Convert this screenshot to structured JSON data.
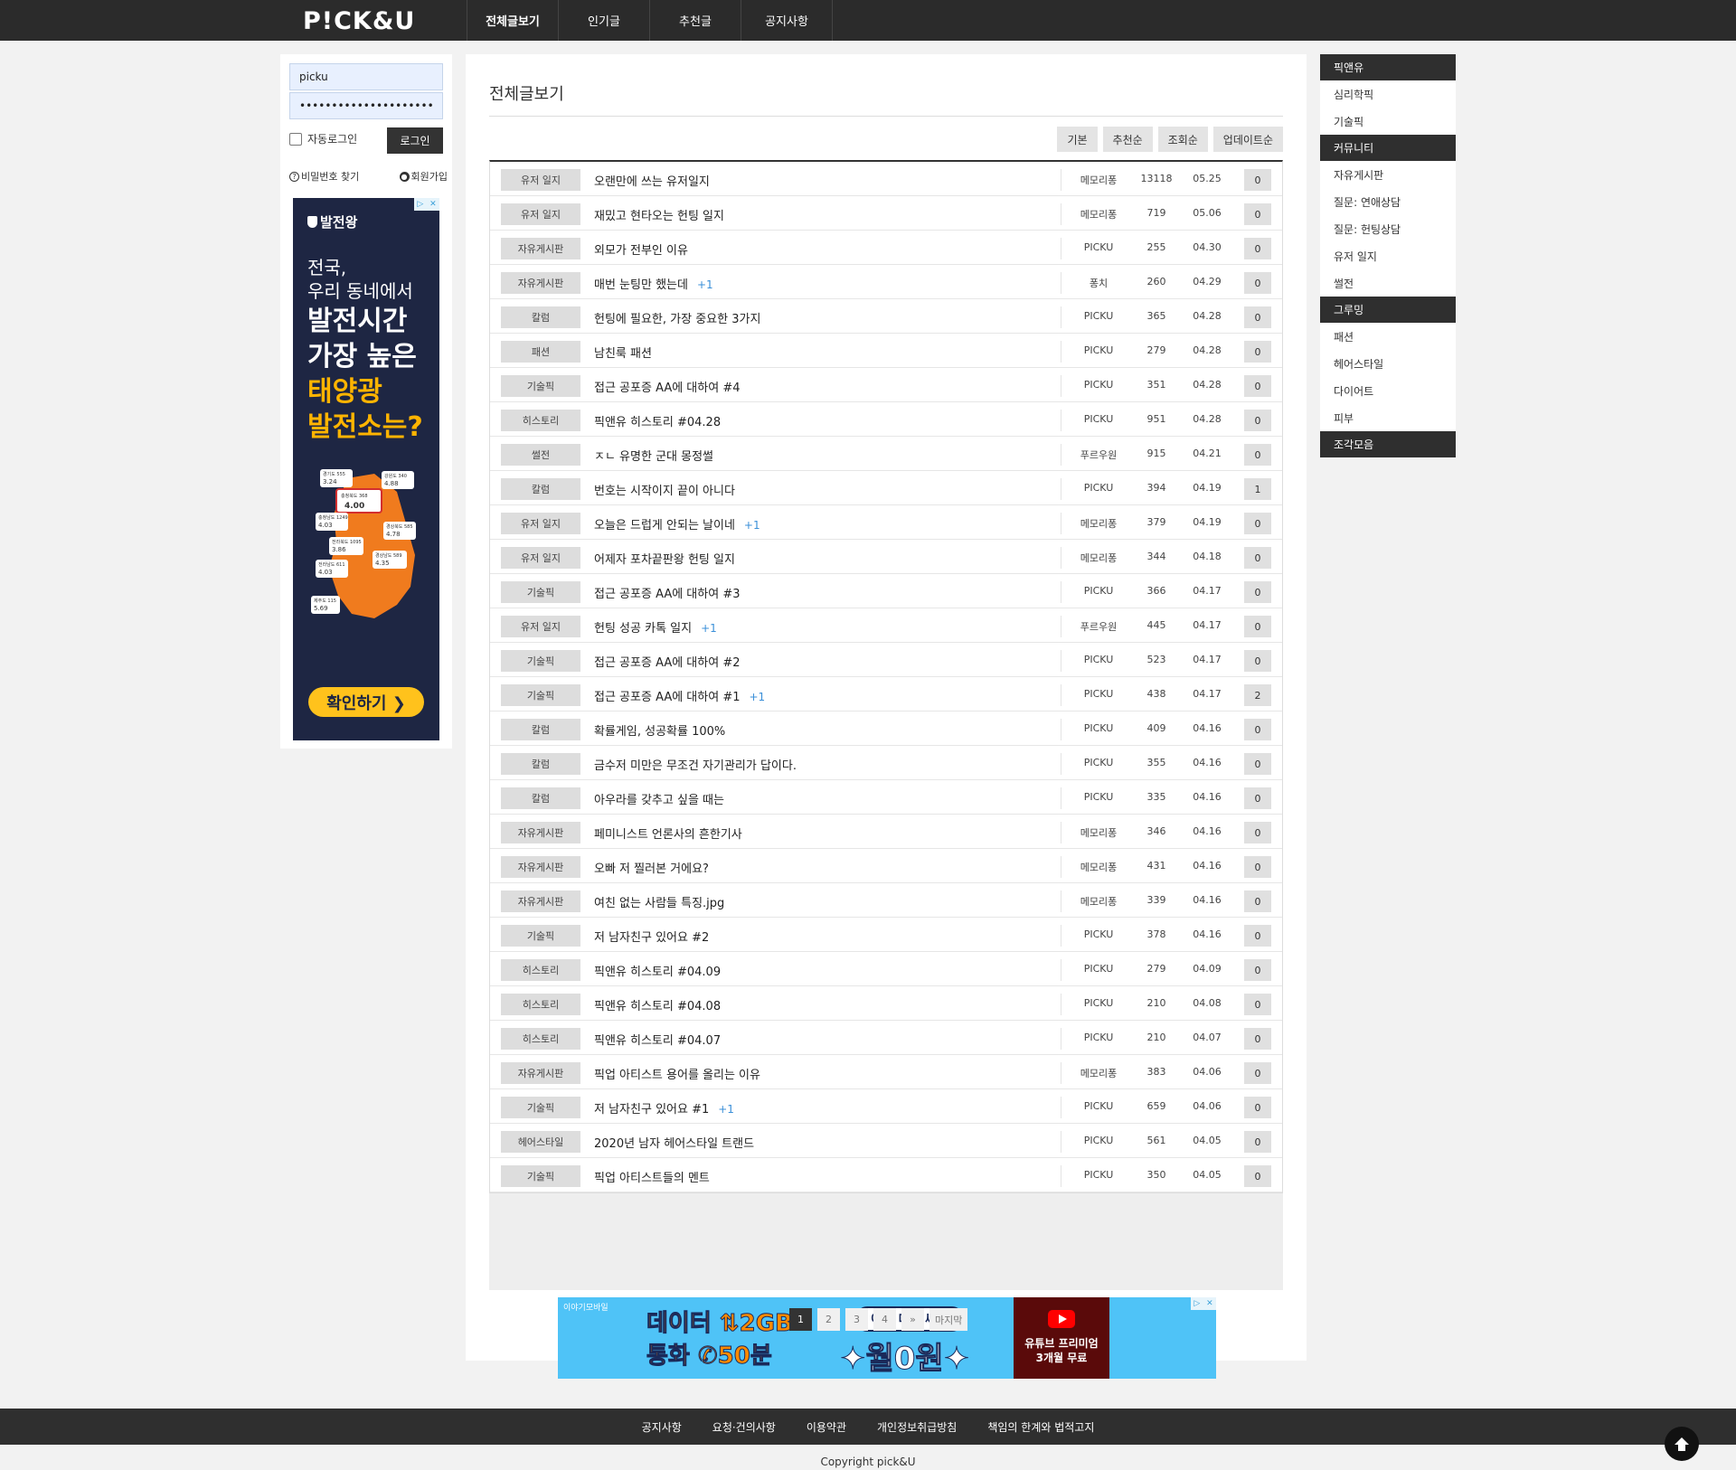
{
  "header": {
    "logo": "P!CK&U",
    "nav": [
      "전체글보기",
      "인기글",
      "추천글",
      "공지사항"
    ]
  },
  "login": {
    "username_value": "picku",
    "password_value": "••••••••••••••••••••••••••",
    "auto_login_label": "자동로그인",
    "login_button": "로그인",
    "find_password": "비밀번호 찾기",
    "signup": "회원가입"
  },
  "ad_left": {
    "brand": "발전왕",
    "line1a": "전국,",
    "line1b": "우리 동네에서",
    "line2a": "발전시간",
    "line2b": "가장 높은",
    "line3a": "태양광",
    "line3b": "발전소는?",
    "cta": "확인하기 ❯",
    "map_labels": {
      "gyeonggi": "경기도 555",
      "gyeonggi_v": "3.24",
      "gangwon": "강원도 340",
      "gangwon_v": "4.88",
      "chungbuk": "충청북도 368",
      "chungbuk_v": "4.00",
      "chungnam": "충청남도 1249",
      "chungnam_v": "4.03",
      "gyeongbuk": "경상북도 585",
      "gyeongbuk_v": "4.78",
      "jeonbuk": "전라북도 1095",
      "jeonbuk_v": "3.86",
      "gyeongnam": "경상남도 589",
      "gyeongnam_v": "4.35",
      "jeonnam": "전라남도 611",
      "jeonnam_v": "4.03",
      "jeju": "제주도 115",
      "jeju_v": "5.69"
    }
  },
  "main": {
    "title": "전체글보기",
    "sort_tabs": [
      "기본",
      "추천순",
      "조회순",
      "업데이트순"
    ],
    "posts": [
      {
        "cat": "유저 일지",
        "title": "오랜만에 쓰는 유저일지",
        "cmt": "",
        "author": "메모리퐁",
        "views": "13118",
        "date": "05.25",
        "likes": "0"
      },
      {
        "cat": "유저 일지",
        "title": "재밌고 현타오는 헌팅 일지",
        "cmt": "",
        "author": "메모리퐁",
        "views": "719",
        "date": "05.06",
        "likes": "0"
      },
      {
        "cat": "자유게시판",
        "title": "외모가 전부인 이유",
        "cmt": "",
        "author": "PICKU",
        "views": "255",
        "date": "04.30",
        "likes": "0"
      },
      {
        "cat": "자유게시판",
        "title": "매번 눈팅만 했는데",
        "cmt": "+1",
        "author": "퐁치",
        "views": "260",
        "date": "04.29",
        "likes": "0"
      },
      {
        "cat": "칼럼",
        "title": "헌팅에 필요한, 가장 중요한 3가지",
        "cmt": "",
        "author": "PICKU",
        "views": "365",
        "date": "04.28",
        "likes": "0"
      },
      {
        "cat": "패션",
        "title": "남친룩 패션",
        "cmt": "",
        "author": "PICKU",
        "views": "279",
        "date": "04.28",
        "likes": "0"
      },
      {
        "cat": "기술픽",
        "title": "접근 공포증 AA에 대하여 #4",
        "cmt": "",
        "author": "PICKU",
        "views": "351",
        "date": "04.28",
        "likes": "0"
      },
      {
        "cat": "히스토리",
        "title": "픽앤유 히스토리 #04.28",
        "cmt": "",
        "author": "PICKU",
        "views": "951",
        "date": "04.28",
        "likes": "0"
      },
      {
        "cat": "썰전",
        "title": "ㅈㄴ 유명한 군대 몽정썰",
        "cmt": "",
        "author": "푸르우원",
        "views": "915",
        "date": "04.21",
        "likes": "0"
      },
      {
        "cat": "칼럼",
        "title": "번호는 시작이지 끝이 아니다",
        "cmt": "",
        "author": "PICKU",
        "views": "394",
        "date": "04.19",
        "likes": "1"
      },
      {
        "cat": "유저 일지",
        "title": "오늘은 드럽게 안되는 날이네",
        "cmt": "+1",
        "author": "메모리퐁",
        "views": "379",
        "date": "04.19",
        "likes": "0"
      },
      {
        "cat": "유저 일지",
        "title": "어제자 포차끝판왕 헌팅 일지",
        "cmt": "",
        "author": "메모리퐁",
        "views": "344",
        "date": "04.18",
        "likes": "0"
      },
      {
        "cat": "기술픽",
        "title": "접근 공포증 AA에 대하여 #3",
        "cmt": "",
        "author": "PICKU",
        "views": "366",
        "date": "04.17",
        "likes": "0"
      },
      {
        "cat": "유저 일지",
        "title": "헌팅 성공 카톡 일지",
        "cmt": "+1",
        "author": "푸르우원",
        "views": "445",
        "date": "04.17",
        "likes": "0"
      },
      {
        "cat": "기술픽",
        "title": "접근 공포증 AA에 대하여 #2",
        "cmt": "",
        "author": "PICKU",
        "views": "523",
        "date": "04.17",
        "likes": "0"
      },
      {
        "cat": "기술픽",
        "title": "접근 공포증 AA에 대하여 #1",
        "cmt": "+1",
        "author": "PICKU",
        "views": "438",
        "date": "04.17",
        "likes": "2"
      },
      {
        "cat": "칼럼",
        "title": "확률게임, 성공확률 100%",
        "cmt": "",
        "author": "PICKU",
        "views": "409",
        "date": "04.16",
        "likes": "0"
      },
      {
        "cat": "칼럼",
        "title": "금수저 미만은 무조건 자기관리가 답이다.",
        "cmt": "",
        "author": "PICKU",
        "views": "355",
        "date": "04.16",
        "likes": "0"
      },
      {
        "cat": "칼럼",
        "title": "아우라를 갖추고 싶을 때는",
        "cmt": "",
        "author": "PICKU",
        "views": "335",
        "date": "04.16",
        "likes": "0"
      },
      {
        "cat": "자유게시판",
        "title": "페미니스트 언론사의 흔한기사",
        "cmt": "",
        "author": "메모리퐁",
        "views": "346",
        "date": "04.16",
        "likes": "0"
      },
      {
        "cat": "자유게시판",
        "title": "오빠 저 찔러본 거에요?",
        "cmt": "",
        "author": "메모리퐁",
        "views": "431",
        "date": "04.16",
        "likes": "0"
      },
      {
        "cat": "자유게시판",
        "title": "여친 없는 사람들 특징.jpg",
        "cmt": "",
        "author": "메모리퐁",
        "views": "339",
        "date": "04.16",
        "likes": "0"
      },
      {
        "cat": "기술픽",
        "title": "저 남자친구 있어요 #2",
        "cmt": "",
        "author": "PICKU",
        "views": "378",
        "date": "04.16",
        "likes": "0"
      },
      {
        "cat": "히스토리",
        "title": "픽앤유 히스토리 #04.09",
        "cmt": "",
        "author": "PICKU",
        "views": "279",
        "date": "04.09",
        "likes": "0"
      },
      {
        "cat": "히스토리",
        "title": "픽앤유 히스토리 #04.08",
        "cmt": "",
        "author": "PICKU",
        "views": "210",
        "date": "04.08",
        "likes": "0"
      },
      {
        "cat": "히스토리",
        "title": "픽앤유 히스토리 #04.07",
        "cmt": "",
        "author": "PICKU",
        "views": "210",
        "date": "04.07",
        "likes": "0"
      },
      {
        "cat": "자유게시판",
        "title": "픽업 아티스트 용어를 올리는 이유",
        "cmt": "",
        "author": "메모리퐁",
        "views": "383",
        "date": "04.06",
        "likes": "0"
      },
      {
        "cat": "기술픽",
        "title": "저 남자친구 있어요 #1",
        "cmt": "+1",
        "author": "PICKU",
        "views": "659",
        "date": "04.06",
        "likes": "0"
      },
      {
        "cat": "헤어스타일",
        "title": "2020년 남자 헤어스타일 트랜드",
        "cmt": "",
        "author": "PICKU",
        "views": "561",
        "date": "04.05",
        "likes": "0"
      },
      {
        "cat": "기술픽",
        "title": "픽업 아티스트들의 멘트",
        "cmt": "",
        "author": "PICKU",
        "views": "350",
        "date": "04.05",
        "likes": "0"
      }
    ],
    "pager": [
      "1",
      "2",
      "3",
      "4",
      "»",
      "마지막"
    ]
  },
  "ad_bottom": {
    "small": "이야기모바일",
    "t1": "데이터 ⇅2GB",
    "t2": "통화 ✆50분",
    "t3": "이게 다~ 써도",
    "t4": "✦월0원✦",
    "yt1": "유튜브 프리미엄",
    "yt2": "3개월 무료"
  },
  "right_menu": [
    {
      "head": "픽앤유",
      "items": [
        "심리학픽",
        "기술픽"
      ]
    },
    {
      "head": "커뮤니티",
      "items": [
        "자유게시판",
        "질문: 연애상담",
        "질문: 헌팅상담",
        "유저 일지",
        "썰전"
      ]
    },
    {
      "head": "그루밍",
      "items": [
        "패션",
        "헤어스타일",
        "다이어트",
        "피부"
      ]
    },
    {
      "head": "조각모음",
      "items": []
    }
  ],
  "footer": {
    "links": [
      "공지사항",
      "요청·건의사항",
      "이용약관",
      "개인정보취급방침",
      "책임의 한계와 법적고지"
    ],
    "copyright": "Copyright pick&U"
  },
  "colors": {
    "topbar": "#2b2b2b",
    "comment_count": "#3a8fd8",
    "ad_left_bg": "#1e2643",
    "ad_left_accent": "#ffb400",
    "ad_bottom_bg": "#4fc3f7"
  }
}
